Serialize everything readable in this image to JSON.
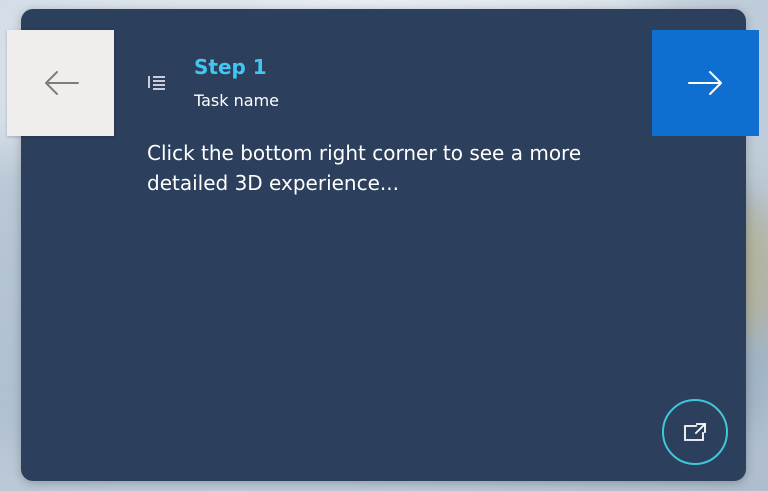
{
  "step": {
    "title": "Step 1",
    "task_name": "Task name",
    "instruction": "Click the bottom right corner to see a more detailed 3D experience..."
  },
  "navigation": {
    "back_icon": "arrow-left-icon",
    "next_icon": "arrow-right-icon",
    "step_list_icon": "list-icon",
    "expand_icon": "open-in-new-window-icon"
  },
  "colors": {
    "card_background": "#2c3f5c",
    "step_title": "#40c8f2",
    "next_button": "#0f6fd1",
    "back_button": "#efeeed",
    "expand_ring": "#3fc8d8"
  }
}
